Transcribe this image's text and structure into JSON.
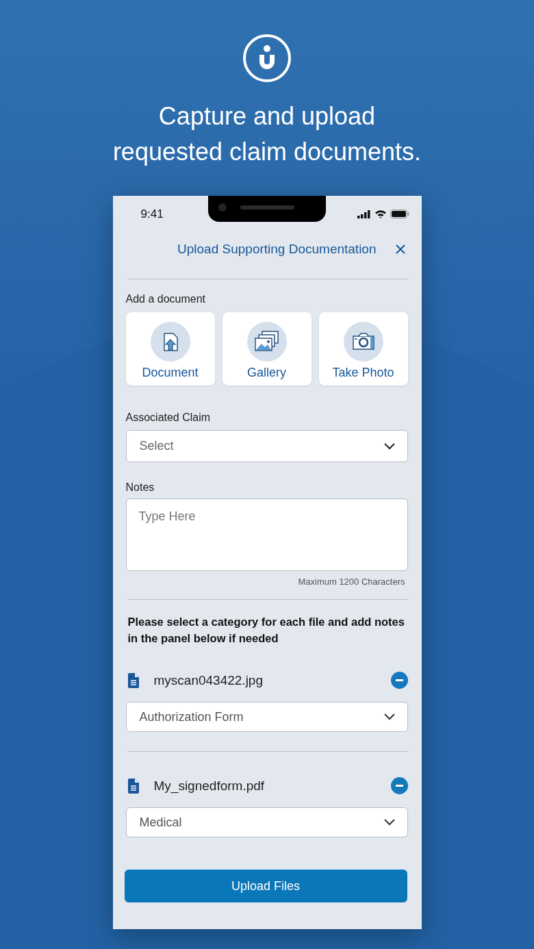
{
  "header": {
    "title_lines": [
      "Capture and upload",
      "requested claim documents."
    ]
  },
  "status_bar": {
    "time": "9:41"
  },
  "dialog": {
    "title": "Upload Supporting Documentation"
  },
  "add_document": {
    "label": "Add a document",
    "options": [
      {
        "label": "Document",
        "kind": "document"
      },
      {
        "label": "Gallery",
        "kind": "gallery"
      },
      {
        "label": "Take Photo",
        "kind": "camera"
      }
    ]
  },
  "claim": {
    "label": "Associated Claim",
    "placeholder": "Select"
  },
  "notes": {
    "label": "Notes",
    "placeholder": "Type Here",
    "limit_note": "Maximum 1200 Characters"
  },
  "instructions": "Please select a category for each file and add notes in the panel below if needed",
  "files": [
    {
      "name": "myscan043422.jpg",
      "category": "Authorization Form"
    },
    {
      "name": "My_signedform.pdf",
      "category": "Medical"
    }
  ],
  "upload_button": "Upload Files"
}
